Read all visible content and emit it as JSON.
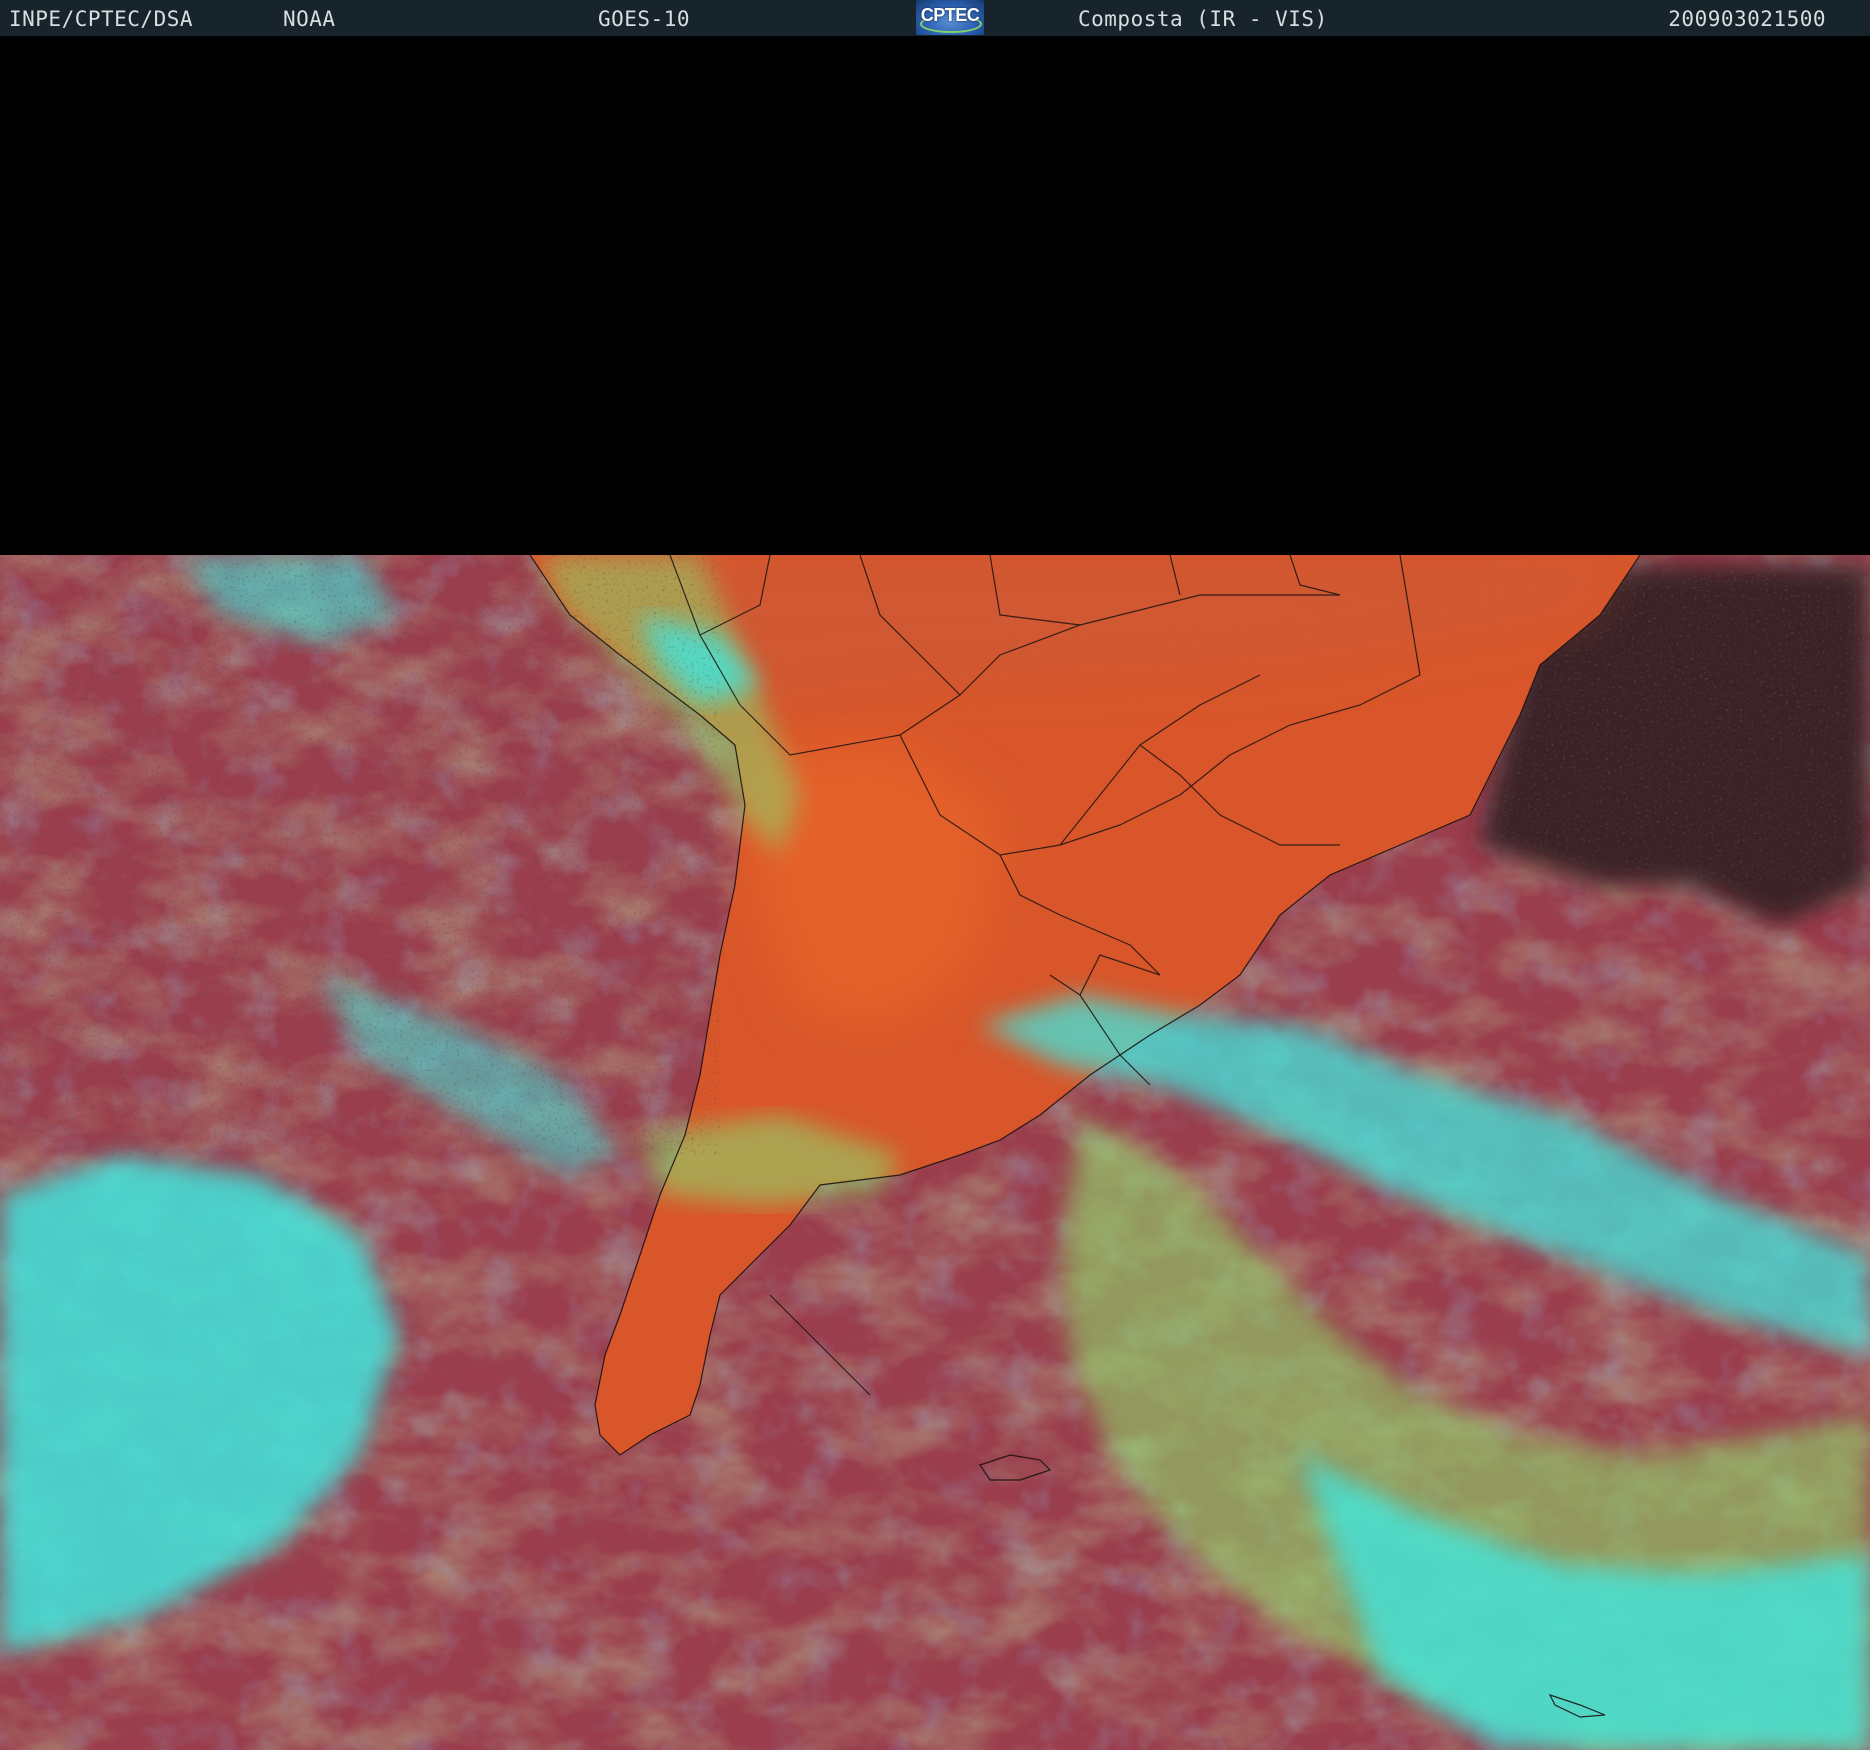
{
  "header": {
    "organization": "INPE/CPTEC/DSA",
    "agency": "NOAA",
    "satellite": "GOES-10",
    "logo_text": "CPTEC",
    "product": "Composta (IR - VIS)",
    "timestamp": "200903021500"
  },
  "imagery": {
    "type": "satellite composite",
    "colors": {
      "ocean_clear": "#9a3d4c",
      "land_clear": "#d8562a",
      "high_cloud": "#3fe6de",
      "mid_cloud": "#8fd66a",
      "thin_cloud": "#4f86d2",
      "no_data": "#000000",
      "header_bg": "#17242c"
    }
  }
}
